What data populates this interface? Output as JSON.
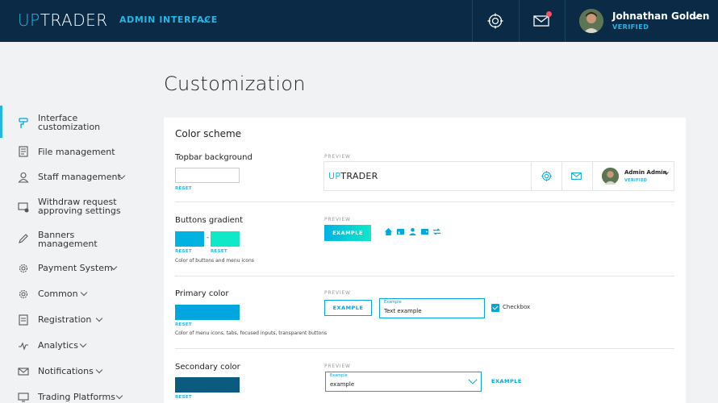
{
  "topbar": {
    "logo_up": "UP",
    "logo_trader": "TRADER",
    "admin_interface": "ADMIN INTERFACE",
    "user_name": "Johnathan Golden",
    "user_status": "VERIFIED",
    "background": "#0a2a45",
    "accent": "#22b8e6"
  },
  "sidebar": {
    "items": [
      {
        "label": "Interface customization",
        "icon": "paint-roller-icon",
        "active": true
      },
      {
        "label": "File management",
        "icon": "file-icon"
      },
      {
        "label": "Staff management",
        "icon": "user-icon",
        "has_submenu": true
      },
      {
        "label": "Withdraw request approving settings",
        "icon": "withdraw-settings-icon"
      },
      {
        "label": "Banners management",
        "icon": "pencil-icon"
      },
      {
        "label": "Payment System",
        "icon": "gear-icon",
        "has_submenu": true
      },
      {
        "label": "Common",
        "icon": "gear-icon",
        "has_submenu": true
      },
      {
        "label": "Registration",
        "icon": "registration-icon",
        "has_submenu": true
      },
      {
        "label": "Analytics",
        "icon": "analytics-icon",
        "has_submenu": true
      },
      {
        "label": "Notifications",
        "icon": "envelope-icon",
        "has_submenu": true
      },
      {
        "label": "Trading Platforms",
        "icon": "monitor-icon",
        "has_submenu": true
      }
    ]
  },
  "main": {
    "title": "Customization",
    "card_title": "Color scheme",
    "preview_label": "PREVIEW",
    "reset_label": "RESET",
    "sections": {
      "topbar_bg": {
        "label": "Topbar background",
        "color": "#ffffff"
      },
      "buttons_gradient": {
        "label": "Buttons gradient",
        "color_from": "#00b2e2",
        "color_to": "#10e8c8",
        "dash": "-",
        "hint": "Color of buttons and menu icons"
      },
      "primary": {
        "label": "Primary color",
        "color": "#00a6dd",
        "hint": "Color of menu icons, tabs, focused inputs, transparent buttons"
      },
      "secondary": {
        "label": "Secondary color",
        "color": "#0d5a80"
      }
    },
    "preview": {
      "logo_up": "UP",
      "logo_trader": "TRADER",
      "user_name": "Admin Admin",
      "user_status": "VERIFIED",
      "example_button": "EXAMPLE",
      "field_label": "Example",
      "field_value": "Text example",
      "checkbox_label": "Checkbox",
      "select_label": "Example",
      "select_value": "example",
      "link_example": "EXAMPLE"
    }
  }
}
